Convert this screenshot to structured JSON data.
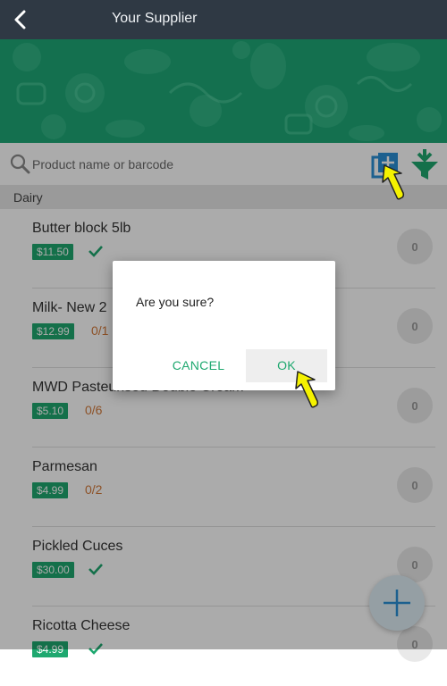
{
  "header": {
    "title": "Your Supplier",
    "back_icon": "chevron-left-icon"
  },
  "search": {
    "placeholder": "Product name or barcode"
  },
  "toolbar": {
    "add_product_icon": "add-product-icon",
    "filter_icon": "funnel-download-icon"
  },
  "section": {
    "name": "Dairy"
  },
  "products": [
    {
      "name": "Butter block 5lb",
      "price": "$11.50",
      "ordered": "",
      "complete": true,
      "qty": "0"
    },
    {
      "name": "Milk- New 2",
      "price": "$12.99",
      "ordered": "0/1",
      "complete": false,
      "qty": "0"
    },
    {
      "name": "MWD Pasteurised Double Cream",
      "price": "$5.10",
      "ordered": "0/6",
      "complete": false,
      "qty": "0"
    },
    {
      "name": "Parmesan",
      "price": "$4.99",
      "ordered": "0/2",
      "complete": false,
      "qty": "0"
    },
    {
      "name": "Pickled Cuces",
      "price": "$30.00",
      "ordered": "",
      "complete": true,
      "qty": "0"
    },
    {
      "name": "Ricotta Cheese",
      "price": "$4.99",
      "ordered": "",
      "complete": true,
      "qty": "0"
    }
  ],
  "dialog": {
    "message": "Are you sure?",
    "cancel_label": "CANCEL",
    "ok_label": "OK"
  },
  "fab": {
    "icon": "plus-icon"
  },
  "colors": {
    "topbar": "#2f3944",
    "brand_green": "#1ea877",
    "price_tag": "#1ea86f",
    "ordered_text": "#d2793a",
    "add_button_blue": "#2a8fd6",
    "pointer_yellow": "#f5f200"
  }
}
